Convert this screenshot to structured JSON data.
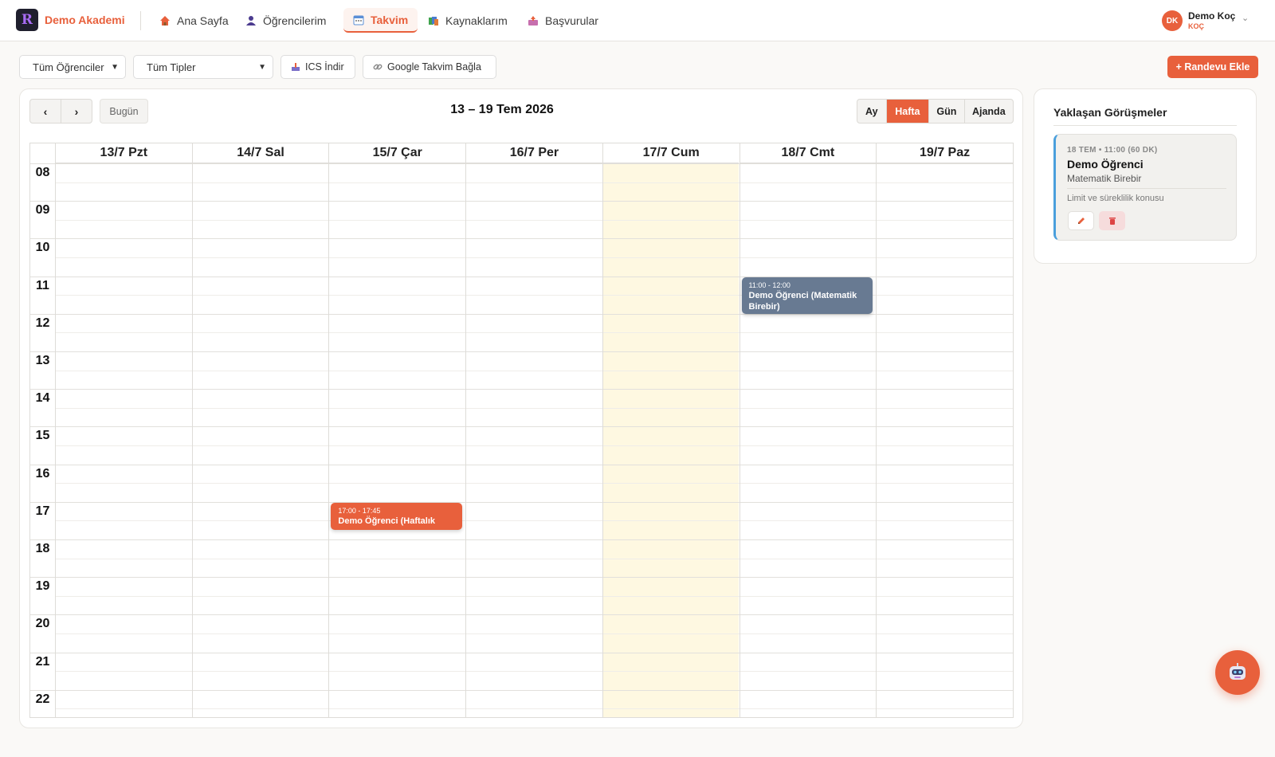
{
  "app": {
    "brand": "Demo Akademi",
    "logo_letter": "R"
  },
  "nav": {
    "items": [
      {
        "label": "Ana Sayfa",
        "icon": "house-icon"
      },
      {
        "label": "Öğrencilerim",
        "icon": "student-icon"
      },
      {
        "label": "Takvim",
        "icon": "calendar-icon",
        "active": true
      },
      {
        "label": "Kaynaklarım",
        "icon": "books-icon"
      },
      {
        "label": "Başvurular",
        "icon": "inbox-icon"
      }
    ]
  },
  "user": {
    "initials": "DK",
    "name": "Demo Koç",
    "role": "KOÇ"
  },
  "toolbar": {
    "student_filter": "Tüm Öğrenciler",
    "type_filter": "Tüm Tipler",
    "ics_label": "ICS İndir",
    "google_label": "Google Takvim Bağla",
    "add_label": "+ Randevu Ekle"
  },
  "calendar": {
    "today_label": "Bugün",
    "range_title": "13 – 19 Tem 2026",
    "views": [
      "Ay",
      "Hafta",
      "Gün",
      "Ajanda"
    ],
    "active_view": "Hafta",
    "days": [
      "13/7 Pzt",
      "14/7 Sal",
      "15/7 Çar",
      "16/7 Per",
      "17/7 Cum",
      "18/7 Cmt",
      "19/7 Paz"
    ],
    "today_index": 4,
    "hours": [
      "08",
      "09",
      "10",
      "11",
      "12",
      "13",
      "14",
      "15",
      "16",
      "17",
      "18",
      "19",
      "20",
      "21",
      "22"
    ],
    "events": [
      {
        "day": 2,
        "start": 17.0,
        "end": 17.75,
        "time": "17:00 - 17:45",
        "title": "Demo Öğrenci (Haftalık",
        "color": "#e8603c"
      },
      {
        "day": 5,
        "start": 11.0,
        "end": 12.0,
        "time": "11:00 - 12:00",
        "title": "Demo Öğrenci (Matematik Birebir)",
        "color": "#687a92"
      }
    ]
  },
  "upcoming": {
    "title": "Yaklaşan Görüşmeler",
    "items": [
      {
        "when": "18 TEM • 11:00 (60 DK)",
        "student": "Demo Öğrenci",
        "type": "Matematik Birebir",
        "note": "Limit ve süreklilik konusu"
      }
    ]
  },
  "fab": {
    "icon": "robot-assistant-icon"
  }
}
